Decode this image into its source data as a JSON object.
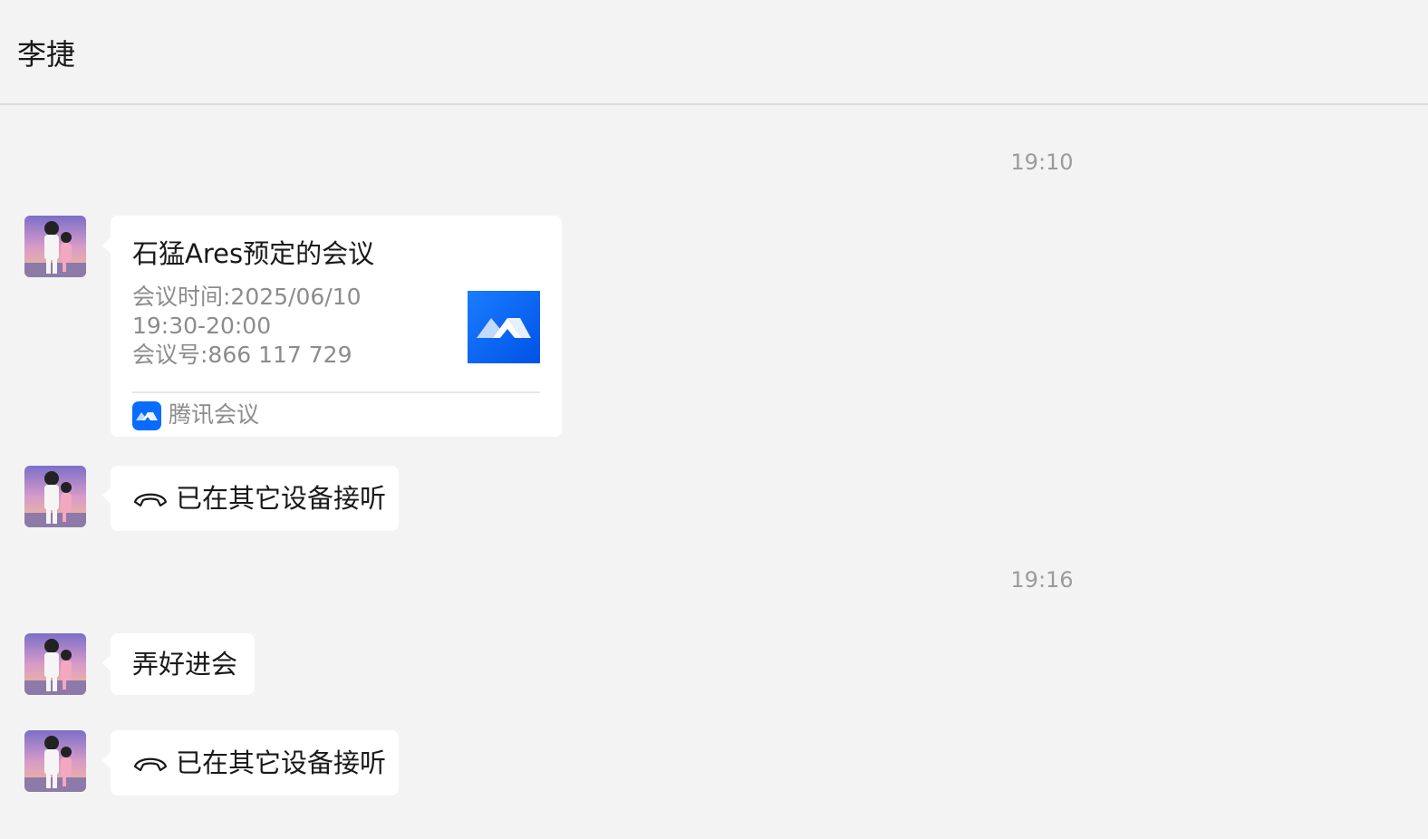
{
  "header": {
    "title": "李捷"
  },
  "messages": {
    "time1": "19:10",
    "card": {
      "title": "石猛Ares预定的会议",
      "meeting_time_line1": "会议时间:2025/06/10",
      "meeting_time_line2": "19:30-20:00",
      "meeting_id": "会议号:866 117 729",
      "app_name": "腾讯会议",
      "thumb_icon": "tencent-meeting-logo",
      "accent": "#0a6cff"
    },
    "call1": {
      "icon": "phone-hangup-icon",
      "text": "已在其它设备接听"
    },
    "time2": "19:16",
    "text1": "弄好进会",
    "call2": {
      "icon": "phone-hangup-icon",
      "text": "已在其它设备接听"
    }
  }
}
